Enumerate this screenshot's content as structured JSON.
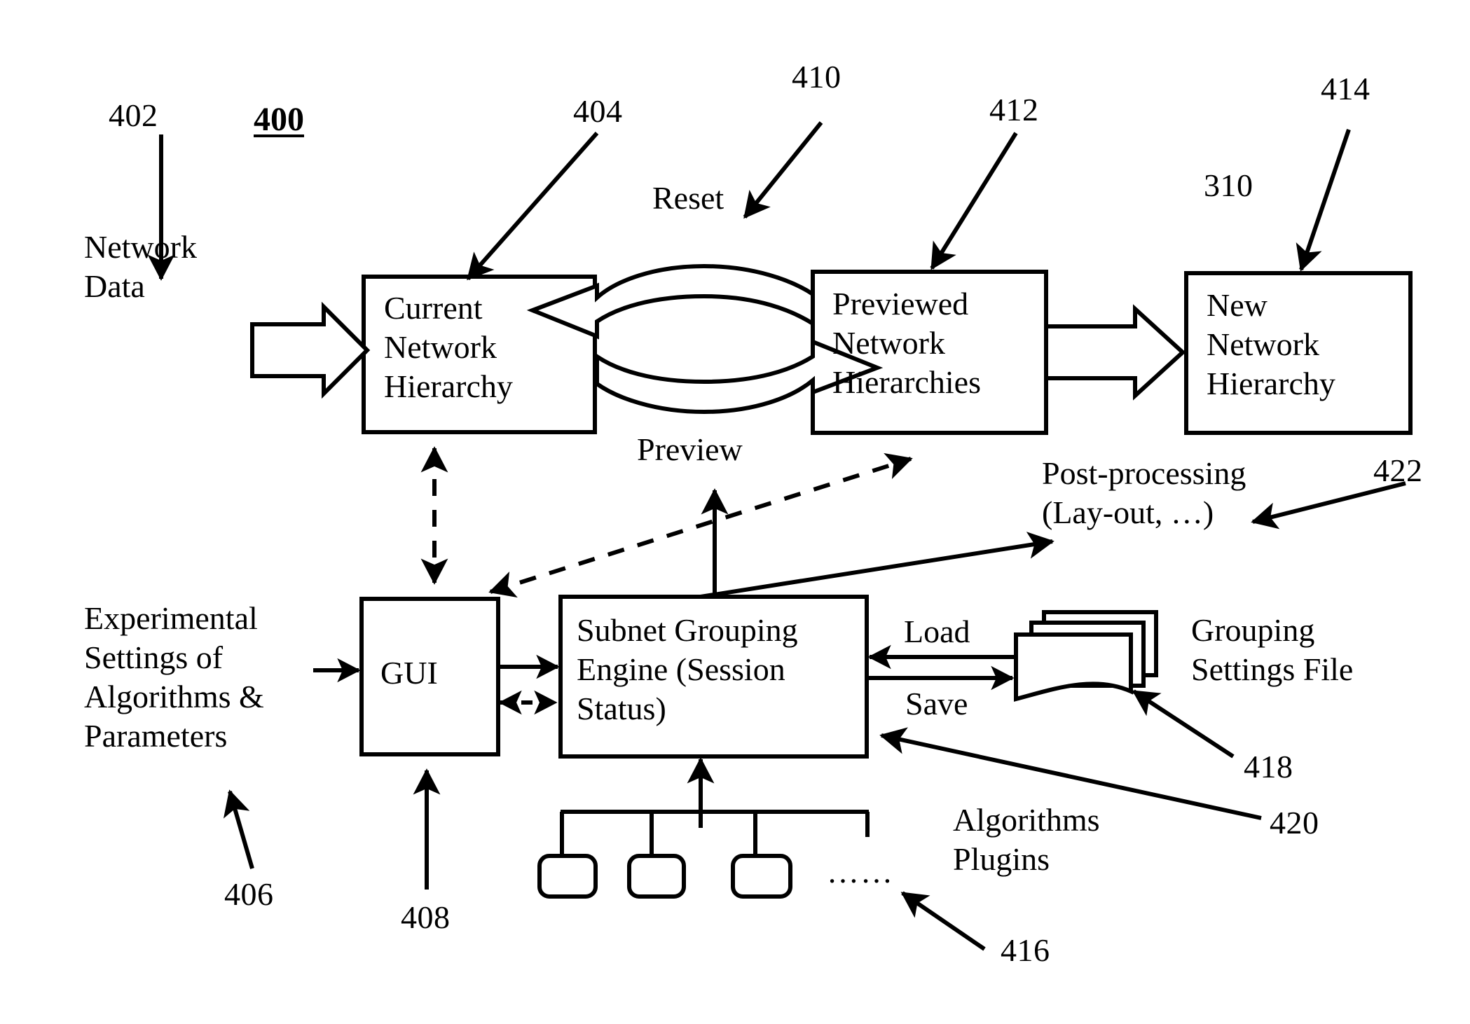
{
  "figure": {
    "number": "400",
    "title_label": "400"
  },
  "boxes": {
    "current_network_hierarchy": "Current\nNetwork\nHierarchy",
    "previewed_network_hierarchies": "Previewed\nNetwork\nHierarchies",
    "new_network_hierarchy": "New\nNetwork\nHierarchy",
    "gui": "GUI",
    "subnet_grouping_engine": "Subnet Grouping\nEngine (Session\nStatus)"
  },
  "free_text": {
    "network_data": "Network\nData",
    "experimental_settings": "Experimental\nSettings of\nAlgorithms &\nParameters",
    "post_processing": "Post-processing\n(Lay-out, …)",
    "grouping_settings_file": "Grouping\nSettings File",
    "algorithms_plugins": "Algorithms\nPlugins",
    "plugin_ellipsis": "……"
  },
  "edge_labels": {
    "reset": "Reset",
    "preview": "Preview",
    "load": "Load",
    "save": "Save"
  },
  "reference_numerals": {
    "n402": "402",
    "n404": "404",
    "n406": "406",
    "n408": "408",
    "n410": "410",
    "n412": "412",
    "n414": "414",
    "n416": "416",
    "n418": "418",
    "n420": "420",
    "n422": "422",
    "n310": "310"
  },
  "colors": {
    "ink": "#000000",
    "paper": "#ffffff"
  },
  "icons": {
    "block_arrow": "block-arrow-icon",
    "curved_block_arrow": "curved-block-arrow-icon",
    "file_stack": "file-stack-icon",
    "plugin_node": "plugin-node-icon"
  }
}
